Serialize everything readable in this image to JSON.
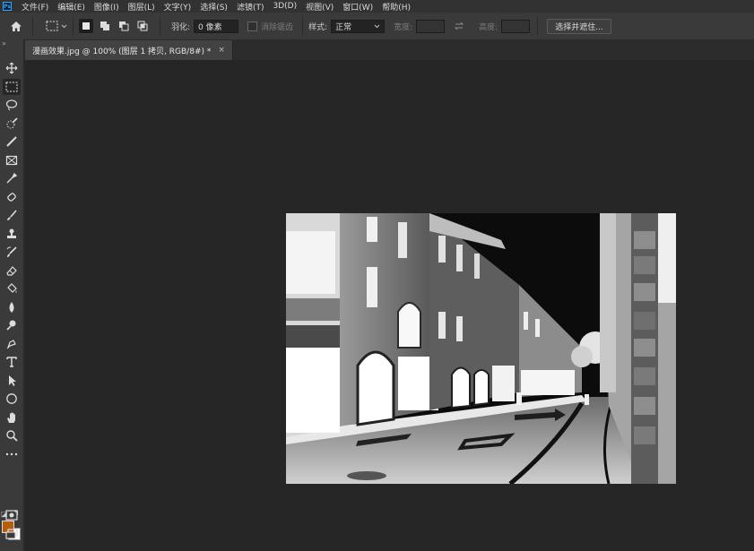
{
  "app": {
    "logo": "Ps"
  },
  "menu": [
    "文件(F)",
    "编辑(E)",
    "图像(I)",
    "图层(L)",
    "文字(Y)",
    "选择(S)",
    "滤镜(T)",
    "3D(D)",
    "视图(V)",
    "窗口(W)",
    "帮助(H)"
  ],
  "options": {
    "feather_label": "羽化:",
    "feather_value": "0 像素",
    "antialias_label": "消除锯齿",
    "style_label": "样式:",
    "style_value": "正常",
    "width_label": "宽度:",
    "height_label": "高度:",
    "select_mask_button": "选择并遮住..."
  },
  "document": {
    "tab_title": "漫画效果.jpg @ 100% (图层 1 拷贝, RGB/8#) *",
    "close_glyph": "×"
  },
  "toolbar": {
    "tools": [
      "move-icon",
      "rectangular-marquee-icon",
      "lasso-icon",
      "quick-selection-icon",
      "eyedropper-brush-icon",
      "frame-icon",
      "eyedropper-icon",
      "healing-brush-icon",
      "brush-icon",
      "clone-stamp-icon",
      "history-brush-icon",
      "eraser-icon",
      "paint-bucket-icon",
      "blur-icon",
      "dodge-icon",
      "pen-icon",
      "type-icon",
      "path-selection-icon",
      "ellipse-icon",
      "hand-icon",
      "zoom-icon",
      "more-icon"
    ],
    "foreground_color": "#b85e0a",
    "background_color": "#ffffff"
  }
}
